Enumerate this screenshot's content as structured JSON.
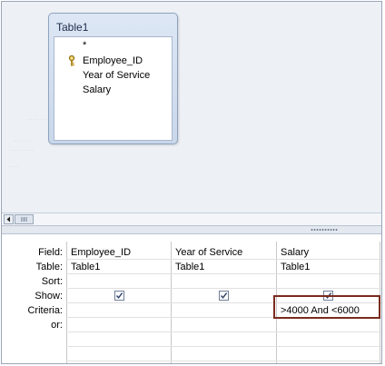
{
  "table_box": {
    "title": "Table1",
    "fields": [
      "*",
      "Employee_ID",
      "Year of Service",
      "Salary"
    ]
  },
  "grid": {
    "row_labels": [
      "Field:",
      "Table:",
      "Sort:",
      "Show:",
      "Criteria:",
      "or:"
    ],
    "columns": [
      {
        "field": "Employee_ID",
        "table": "Table1",
        "show": true,
        "criteria": ""
      },
      {
        "field": "Year of Service",
        "table": "Table1",
        "show": true,
        "criteria": ""
      },
      {
        "field": "Salary",
        "table": "Table1",
        "show": true,
        "criteria": ">4000 And <6000"
      }
    ]
  },
  "colors": {
    "highlight_border": "#7a2b1e",
    "design_background": "#edf0f5"
  }
}
